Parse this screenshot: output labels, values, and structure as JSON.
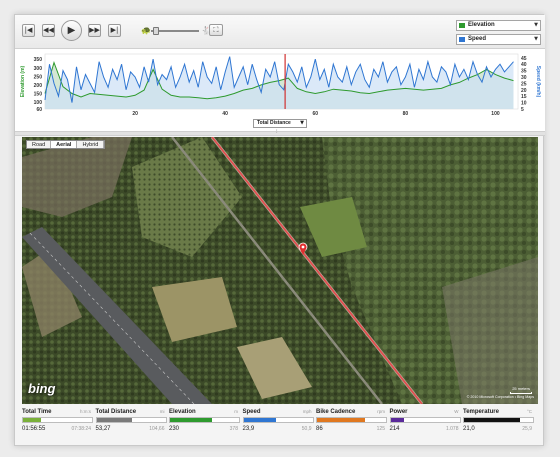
{
  "controls": {
    "icons": [
      "skip-back-icon",
      "rewind-icon",
      "play-icon",
      "fast-forward-icon",
      "skip-forward-icon",
      "slow-icon",
      "fast-icon",
      "fullscreen-icon"
    ],
    "glyphs": {
      "skip_back": "|◀",
      "rewind": "◀◀",
      "play": "▶",
      "fast_forward": "▶▶",
      "skip_forward": "▶|",
      "slow": "🐢",
      "fast": "🐇",
      "fullscreen": "⛶"
    },
    "playback_speed_fraction": 0.1
  },
  "series_selectors": [
    {
      "label": "Elevation",
      "color": "#2e9a2e"
    },
    {
      "label": "Speed",
      "color": "#2f76d2"
    }
  ],
  "chart_data": {
    "type": "area",
    "xaxis_selector": "Total Distance",
    "x_ticks": [
      20,
      40,
      60,
      80,
      100
    ],
    "xlim": [
      0,
      105
    ],
    "left_axis": {
      "label": "Elevation (m)",
      "ticks": [
        60,
        100,
        150,
        200,
        250,
        300,
        350
      ],
      "ylim": [
        60,
        380
      ],
      "color": "#2e9a2e"
    },
    "right_axis": {
      "label": "Speed (km/h)",
      "ticks": [
        5,
        10,
        15,
        20,
        25,
        30,
        35,
        40,
        45
      ],
      "ylim": [
        5,
        48
      ],
      "color": "#2f76d2"
    },
    "cursor_x": 53.3,
    "series": [
      {
        "name": "Elevation",
        "color": "#2e9a2e",
        "fill": "#c5dfc5",
        "x": [
          0,
          2,
          4,
          6,
          8,
          10,
          12,
          14,
          16,
          18,
          20,
          22,
          24,
          26,
          28,
          30,
          32,
          34,
          36,
          38,
          40,
          42,
          44,
          46,
          48,
          50,
          52,
          54,
          56,
          58,
          60,
          62,
          64,
          66,
          68,
          70,
          72,
          74,
          76,
          78,
          80,
          82,
          84,
          86,
          88,
          90,
          92,
          94,
          96,
          98,
          100,
          102,
          104
        ],
        "values": [
          150,
          330,
          190,
          150,
          130,
          150,
          145,
          140,
          135,
          130,
          140,
          170,
          290,
          175,
          140,
          130,
          130,
          125,
          120,
          125,
          135,
          150,
          170,
          180,
          200,
          215,
          225,
          240,
          180,
          160,
          150,
          160,
          175,
          170,
          165,
          155,
          150,
          160,
          170,
          175,
          180,
          175,
          170,
          175,
          180,
          200,
          215,
          240,
          260,
          290,
          260,
          240,
          225
        ]
      },
      {
        "name": "Speed",
        "color": "#2f76d2",
        "fill": "#cfe2f6",
        "x": [
          0,
          1,
          2,
          3,
          4,
          5,
          6,
          7,
          8,
          9,
          10,
          11,
          12,
          13,
          14,
          15,
          16,
          17,
          18,
          19,
          20,
          21,
          22,
          23,
          24,
          25,
          26,
          27,
          28,
          29,
          30,
          31,
          32,
          33,
          34,
          35,
          36,
          37,
          38,
          39,
          40,
          41,
          42,
          43,
          44,
          45,
          46,
          47,
          48,
          49,
          50,
          51,
          52,
          53,
          54,
          55,
          56,
          57,
          58,
          59,
          60,
          61,
          62,
          63,
          64,
          65,
          66,
          67,
          68,
          69,
          70,
          71,
          72,
          73,
          74,
          75,
          76,
          77,
          78,
          79,
          80,
          81,
          82,
          83,
          84,
          85,
          86,
          87,
          88,
          89,
          90,
          91,
          92,
          93,
          94,
          95,
          96,
          97,
          98,
          99,
          100,
          101,
          102,
          103,
          104
        ],
        "values": [
          12,
          40,
          25,
          15,
          35,
          28,
          10,
          38,
          20,
          32,
          25,
          18,
          42,
          30,
          22,
          36,
          28,
          40,
          20,
          34,
          30,
          22,
          38,
          26,
          44,
          24,
          32,
          28,
          38,
          22,
          30,
          40,
          26,
          35,
          22,
          42,
          30,
          25,
          38,
          20,
          34,
          46,
          22,
          30,
          38,
          24,
          40,
          28,
          18,
          36,
          30,
          42,
          24,
          20,
          40,
          34,
          26,
          38,
          22,
          30,
          44,
          28,
          36,
          22,
          40,
          30,
          26,
          38,
          24,
          34,
          40,
          28,
          22,
          36,
          30,
          42,
          26,
          34,
          38,
          24,
          30,
          40,
          22,
          36,
          28,
          42,
          30,
          26,
          38,
          34,
          24,
          40,
          30,
          36,
          28,
          42,
          32,
          26,
          38,
          30,
          36,
          40,
          34,
          38,
          42
        ]
      }
    ]
  },
  "map": {
    "tabs": [
      "Road",
      "Aerial",
      "Hybrid"
    ],
    "active_tab": "Aerial",
    "logo": "bing",
    "scale_label": "25 meters",
    "copyright": "© 2010 Microsoft Corporation • Bing Maps",
    "marker_icon": "location-pin-icon",
    "route_color": "#e05050"
  },
  "stats": [
    {
      "title": "Total Time",
      "unit": "h:m:s",
      "current": "01:56:55",
      "max": "07:38:24",
      "fraction": 0.26,
      "color": "#7ab03a"
    },
    {
      "title": "Total Distance",
      "unit": "mi",
      "current": "53,27",
      "max": "104,66",
      "fraction": 0.51,
      "color": "#7a7a7a"
    },
    {
      "title": "Elevation",
      "unit": "m",
      "current": "230",
      "max": "378",
      "fraction": 0.61,
      "color": "#2e9a2e"
    },
    {
      "title": "Speed",
      "unit": "mph",
      "current": "23,9",
      "max": "50,9",
      "fraction": 0.47,
      "color": "#2f76d2"
    },
    {
      "title": "Bike Cadence",
      "unit": "rpm",
      "current": "86",
      "max": "125",
      "fraction": 0.69,
      "color": "#e07820"
    },
    {
      "title": "Power",
      "unit": "W",
      "current": "214",
      "max": "1.078",
      "fraction": 0.2,
      "color": "#5a2a9a"
    },
    {
      "title": "Temperature",
      "unit": "°C",
      "current": "21,0",
      "max": "25,9",
      "fraction": 0.81,
      "color": "#111111"
    }
  ]
}
